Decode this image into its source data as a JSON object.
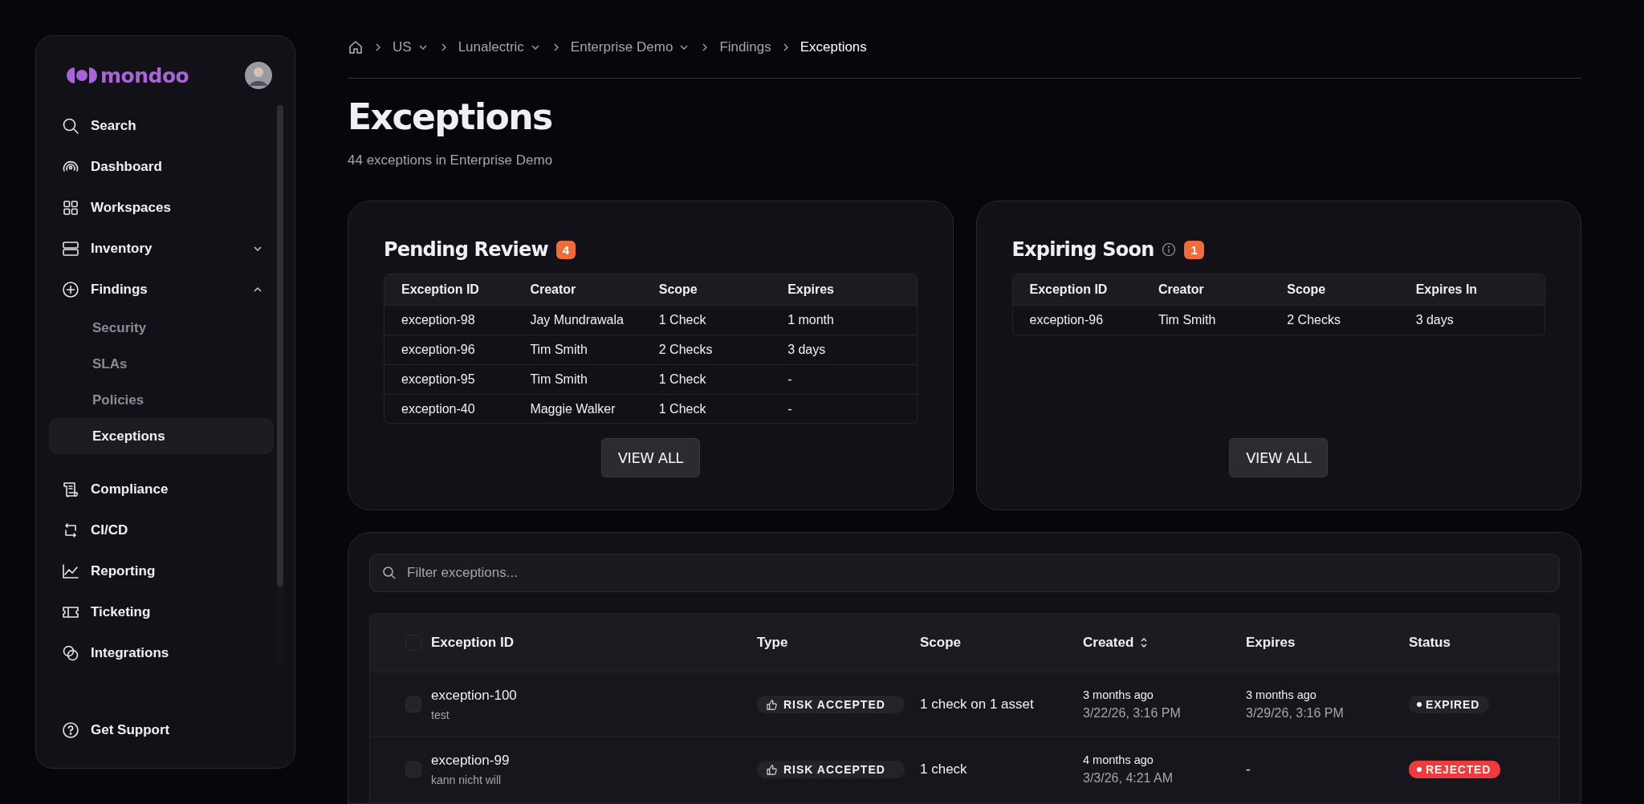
{
  "sidebar": {
    "logo": "mondoo",
    "items": [
      {
        "label": "Search",
        "kind": "search"
      },
      {
        "label": "Dashboard",
        "kind": "dashboard"
      },
      {
        "label": "Workspaces",
        "kind": "grid"
      },
      {
        "label": "Inventory",
        "kind": "server",
        "expanded": false
      },
      {
        "label": "Findings",
        "kind": "plus",
        "expanded": true,
        "children": [
          {
            "label": "Security",
            "selected": false
          },
          {
            "label": "SLAs",
            "selected": false
          },
          {
            "label": "Policies",
            "selected": false
          },
          {
            "label": "Exceptions",
            "selected": true
          }
        ]
      },
      {
        "label": "Compliance",
        "kind": "scroll"
      },
      {
        "label": "CI/CD",
        "kind": "cicd"
      },
      {
        "label": "Reporting",
        "kind": "chart"
      },
      {
        "label": "Ticketing",
        "kind": "ticket"
      },
      {
        "label": "Integrations",
        "kind": "rings"
      }
    ],
    "footer": {
      "label": "Get Support"
    }
  },
  "breadcrumbs": [
    {
      "label": "US",
      "dropdown": true,
      "current": false
    },
    {
      "label": "Lunalectric",
      "dropdown": true,
      "current": false
    },
    {
      "label": "Enterprise Demo",
      "dropdown": true,
      "current": false
    },
    {
      "label": "Findings",
      "dropdown": false,
      "current": false
    },
    {
      "label": "Exceptions",
      "dropdown": false,
      "current": true
    }
  ],
  "page": {
    "title": "Exceptions",
    "subtitle": "44 exceptions in Enterprise Demo"
  },
  "cards": [
    {
      "title": "Pending Review",
      "info": false,
      "count": "4",
      "columns": [
        "Exception ID",
        "Creator",
        "Scope",
        "Expires"
      ],
      "rows": [
        [
          "exception-98",
          "Jay Mundrawala",
          "1 Check",
          "1 month"
        ],
        [
          "exception-96",
          "Tim Smith",
          "2 Checks",
          "3 days"
        ],
        [
          "exception-95",
          "Tim Smith",
          "1 Check",
          "-"
        ],
        [
          "exception-40",
          "Maggie Walker",
          "1 Check",
          "-"
        ]
      ],
      "button": "VIEW ALL"
    },
    {
      "title": "Expiring Soon",
      "info": true,
      "count": "1",
      "columns": [
        "Exception ID",
        "Creator",
        "Scope",
        "Expires In"
      ],
      "rows": [
        [
          "exception-96",
          "Tim Smith",
          "2 Checks",
          "3 days"
        ]
      ],
      "button": "VIEW ALL"
    }
  ],
  "filter": {
    "placeholder": "Filter exceptions..."
  },
  "table": {
    "select_all_checked": false,
    "columns": [
      {
        "label": "Exception ID"
      },
      {
        "label": "Type"
      },
      {
        "label": "Scope"
      },
      {
        "label": "Created",
        "sortable": true
      },
      {
        "label": "Expires"
      },
      {
        "label": "Status"
      }
    ],
    "rows": [
      {
        "checked": false,
        "id": "exception-100",
        "note": "test",
        "type": "RISK ACCEPTED",
        "scope": "1 check on 1 asset",
        "created": "3 months ago",
        "created_date": "3/22/26, 3:16 PM",
        "expires": "3 months ago",
        "expires_date": "3/29/26, 3:16 PM",
        "status": "EXPIRED",
        "kind": "expired"
      },
      {
        "checked": false,
        "id": "exception-99",
        "note": "kann nicht will",
        "type": "RISK ACCEPTED",
        "scope": "1 check",
        "created": "4 months ago",
        "created_date": "3/3/26, 4:21 AM",
        "expires": "-",
        "status": "REJECTED",
        "kind": "rejected"
      }
    ]
  }
}
